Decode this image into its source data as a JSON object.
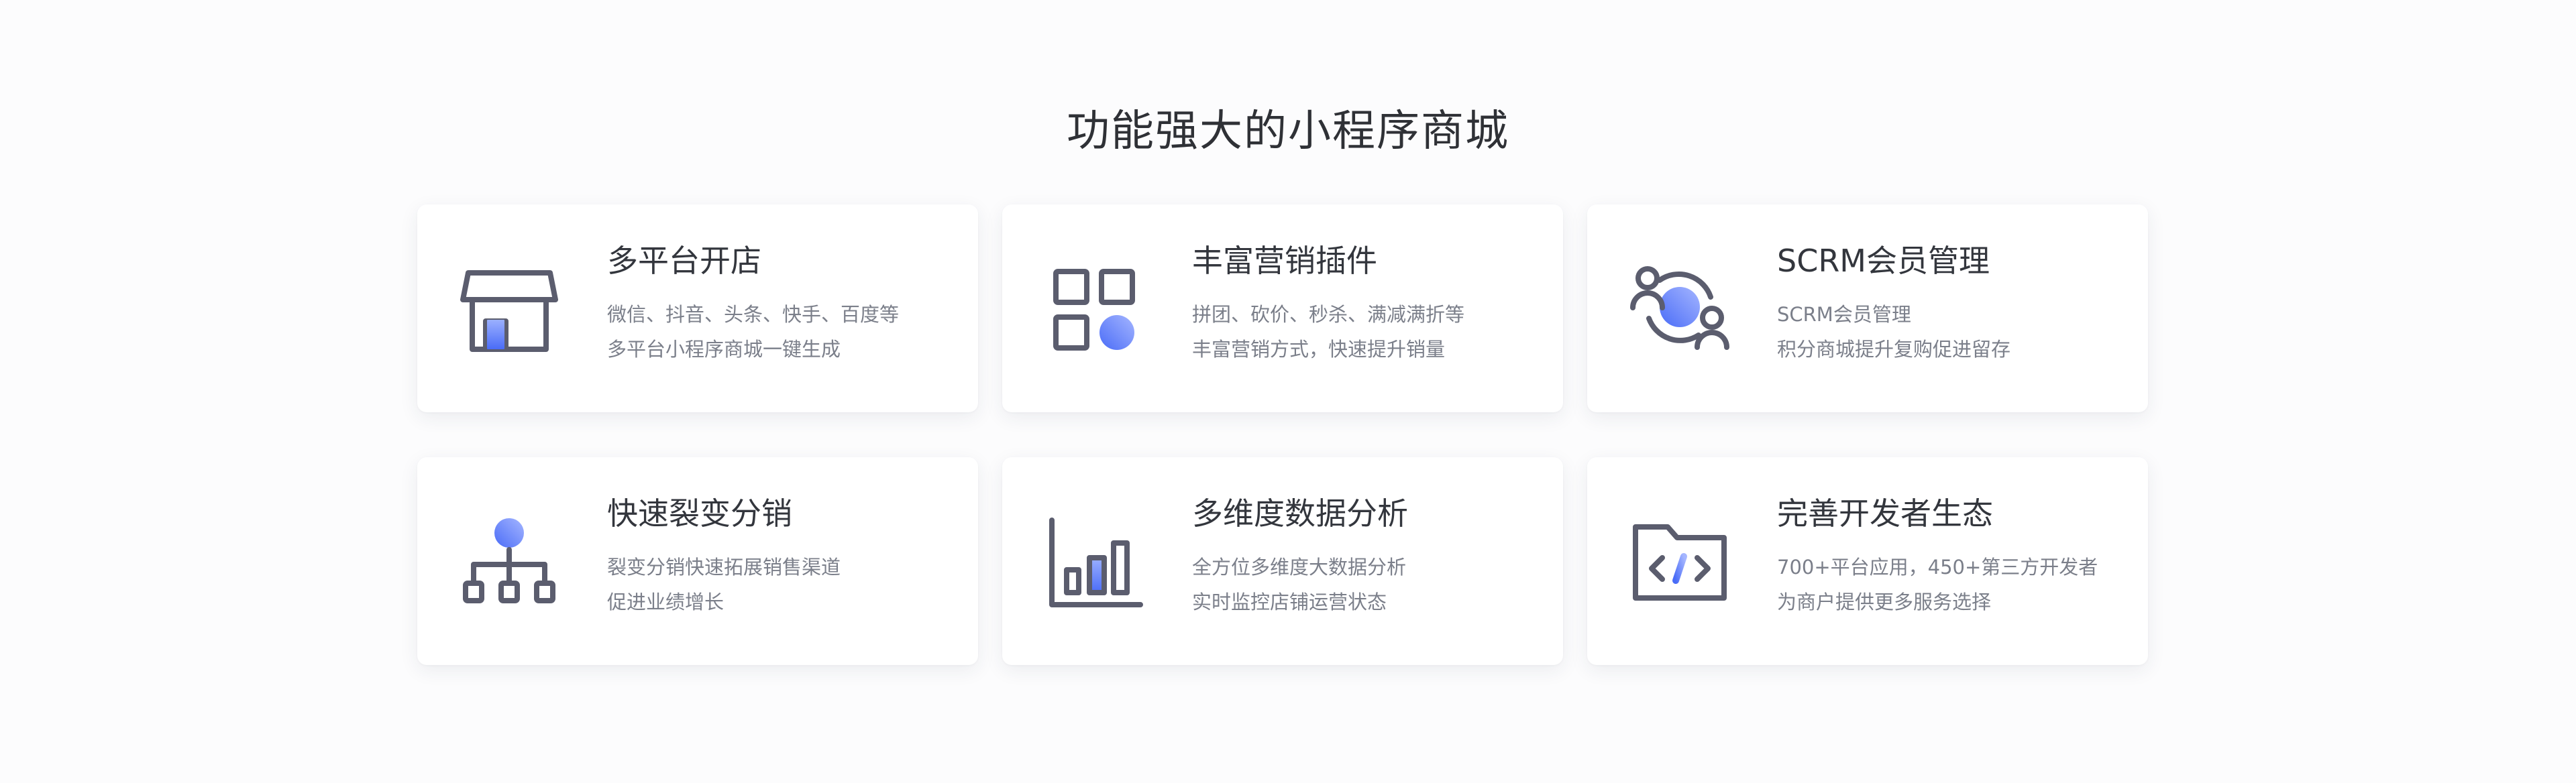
{
  "section": {
    "title": "功能强大的小程序商城"
  },
  "colors": {
    "icon_stroke": "#5b5d6e",
    "accent_gradient_start": "#4a6cf7",
    "accent_gradient_end": "#8fa6ff",
    "title_text": "#33363d",
    "desc_text": "#7b7f8a"
  },
  "features": [
    {
      "icon": "storefront-icon",
      "title": "多平台开店",
      "line1": "微信、抖音、头条、快手、百度等",
      "line2": "多平台小程序商城一键生成"
    },
    {
      "icon": "app-grid-icon",
      "title": "丰富营销插件",
      "line1": "拼团、砍价、秒杀、满减满折等",
      "line2": "丰富营销方式，快速提升销量"
    },
    {
      "icon": "member-cycle-icon",
      "title": "SCRM会员管理",
      "line1": "SCRM会员管理",
      "line2": "积分商城提升复购促进留存"
    },
    {
      "icon": "hierarchy-icon",
      "title": "快速裂变分销",
      "line1": "裂变分销快速拓展销售渠道",
      "line2": "促进业绩增长"
    },
    {
      "icon": "bar-chart-icon",
      "title": "多维度数据分析",
      "line1": "全方位多维度大数据分析",
      "line2": "实时监控店铺运营状态"
    },
    {
      "icon": "code-folder-icon",
      "title": "完善开发者生态",
      "line1": "700+平台应用，450+第三方开发者",
      "line2": "为商户提供更多服务选择"
    }
  ]
}
